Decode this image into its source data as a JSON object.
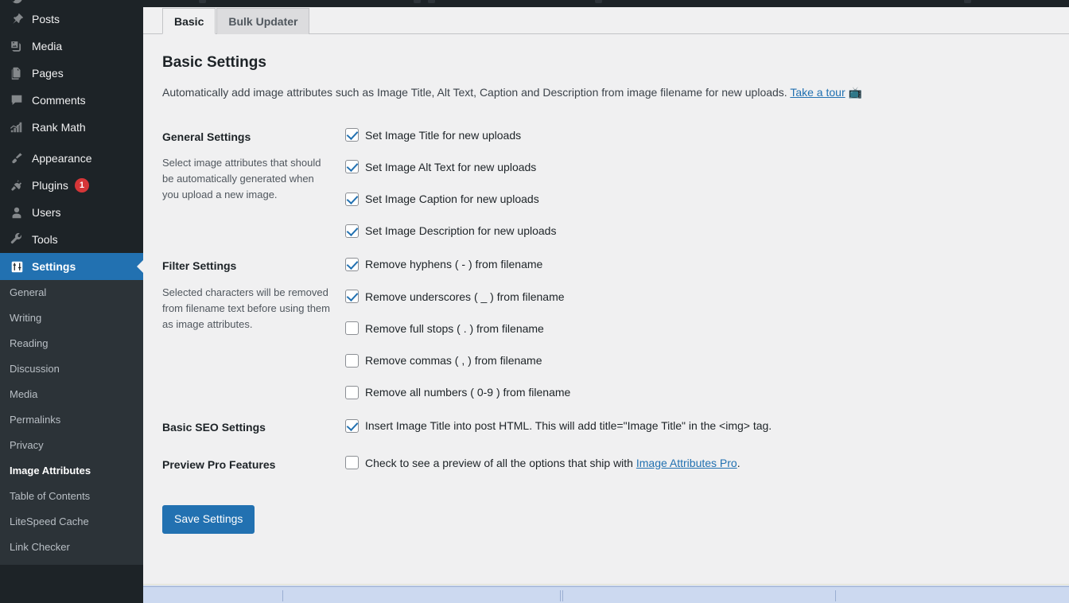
{
  "sidebar": {
    "top_items": [
      {
        "label": "Posts",
        "icon": "pin-icon",
        "current": false,
        "badge": null
      },
      {
        "label": "Media",
        "icon": "media-icon",
        "current": false,
        "badge": null
      },
      {
        "label": "Pages",
        "icon": "pages-icon",
        "current": false,
        "badge": null
      },
      {
        "label": "Comments",
        "icon": "comments-icon",
        "current": false,
        "badge": null
      },
      {
        "label": "Rank Math",
        "icon": "rank-math-icon",
        "current": false,
        "badge": null
      }
    ],
    "second_group": [
      {
        "label": "Appearance",
        "icon": "paintbrush-icon",
        "current": false,
        "badge": null
      },
      {
        "label": "Plugins",
        "icon": "plug-icon",
        "current": false,
        "badge": "1"
      },
      {
        "label": "Users",
        "icon": "user-icon",
        "current": false,
        "badge": null
      },
      {
        "label": "Tools",
        "icon": "wrench-icon",
        "current": false,
        "badge": null
      },
      {
        "label": "Settings",
        "icon": "settings-sliders-icon",
        "current": true,
        "badge": null
      }
    ],
    "submenu": [
      {
        "label": "General",
        "current": false
      },
      {
        "label": "Writing",
        "current": false
      },
      {
        "label": "Reading",
        "current": false
      },
      {
        "label": "Discussion",
        "current": false
      },
      {
        "label": "Media",
        "current": false
      },
      {
        "label": "Permalinks",
        "current": false
      },
      {
        "label": "Privacy",
        "current": false
      },
      {
        "label": "Image Attributes",
        "current": true
      },
      {
        "label": "Table of Contents",
        "current": false
      },
      {
        "label": "LiteSpeed Cache",
        "current": false
      },
      {
        "label": "Link Checker",
        "current": false
      }
    ]
  },
  "tabs": [
    {
      "label": "Basic",
      "active": true
    },
    {
      "label": "Bulk Updater",
      "active": false
    }
  ],
  "page": {
    "title": "Basic Settings",
    "description_text": "Automatically add image attributes such as Image Title, Alt Text, Caption and Description from image filename for new uploads.",
    "tour_link": "Take a tour",
    "tour_icon": "📺"
  },
  "sections": {
    "general": {
      "heading": "General Settings",
      "description": "Select image attributes that should be automatically generated when you upload a new image.",
      "options": [
        {
          "label": "Set Image Title for new uploads",
          "checked": true
        },
        {
          "label": "Set Image Alt Text for new uploads",
          "checked": true
        },
        {
          "label": "Set Image Caption for new uploads",
          "checked": true
        },
        {
          "label": "Set Image Description for new uploads",
          "checked": true
        }
      ]
    },
    "filter": {
      "heading": "Filter Settings",
      "description": "Selected characters will be removed from filename text before using them as image attributes.",
      "options": [
        {
          "label": "Remove hyphens ( - ) from filename",
          "checked": true
        },
        {
          "label": "Remove underscores ( _ ) from filename",
          "checked": true
        },
        {
          "label": "Remove full stops ( . ) from filename",
          "checked": false
        },
        {
          "label": "Remove commas ( , ) from filename",
          "checked": false
        },
        {
          "label": "Remove all numbers ( 0-9 ) from filename",
          "checked": false
        }
      ]
    },
    "seo": {
      "heading": "Basic SEO Settings",
      "option_label": "Insert Image Title into post HTML. This will add title=\"Image Title\" in the <img> tag.",
      "checked": true
    },
    "pro": {
      "heading": "Preview Pro Features",
      "option_prefix": "Check to see a preview of all the options that ship with ",
      "option_link": "Image Attributes Pro",
      "option_suffix": ".",
      "checked": false
    }
  },
  "submit": {
    "label": "Save Settings"
  },
  "colors": {
    "accent": "#2271b1",
    "sidebar_bg": "#1d2327",
    "submenu_bg": "#2c3338",
    "content_bg": "#f0f0f1",
    "badge": "#d63638",
    "taskbar": "#ccd9f0"
  }
}
